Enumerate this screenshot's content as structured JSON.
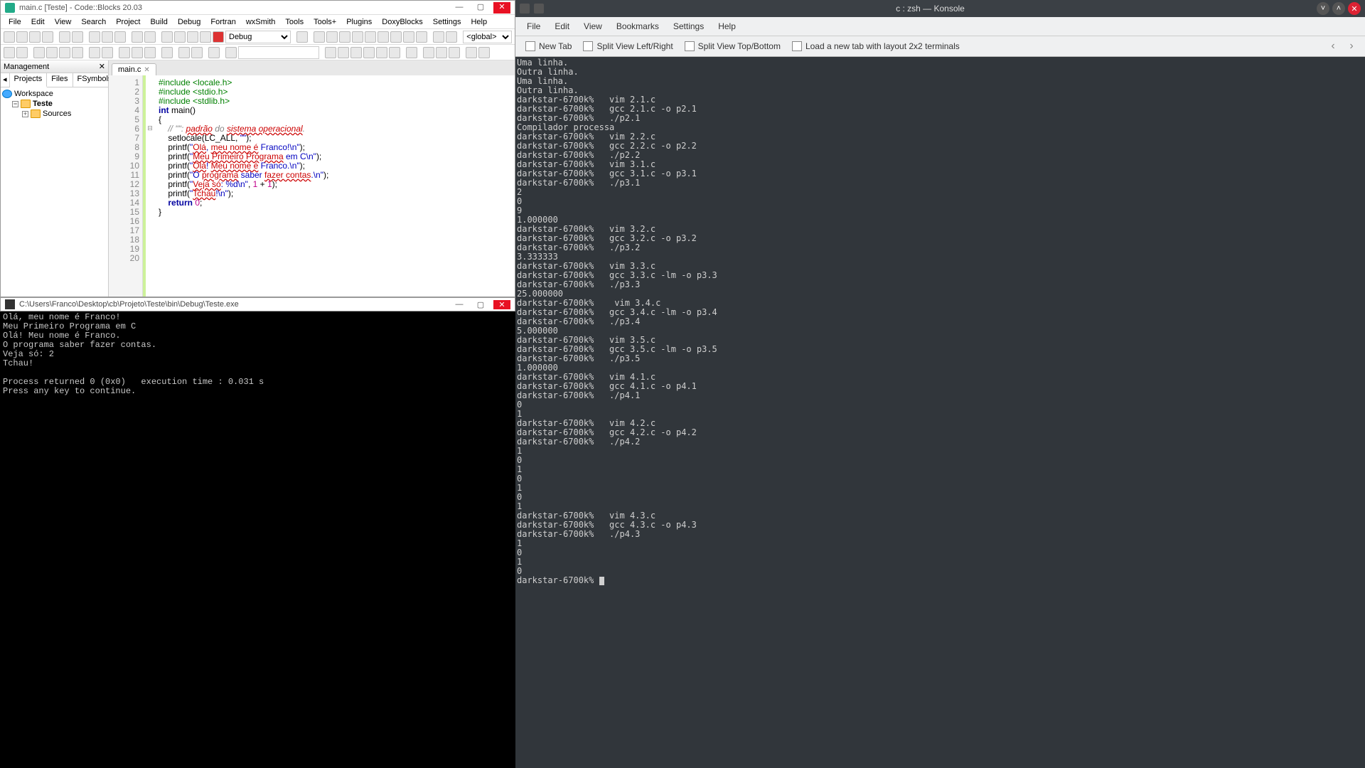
{
  "cb": {
    "title": "main.c [Teste] - Code::Blocks 20.03",
    "menu": [
      "File",
      "Edit",
      "View",
      "Search",
      "Project",
      "Build",
      "Debug",
      "Fortran",
      "wxSmith",
      "Tools",
      "Tools+",
      "Plugins",
      "DoxyBlocks",
      "Settings",
      "Help"
    ],
    "config": "Debug",
    "scope": "<global>",
    "management": {
      "title": "Management",
      "tabs": [
        "Projects",
        "Files",
        "FSymbols"
      ],
      "arrow": "▸",
      "tree": {
        "workspace": "Workspace",
        "project": "Teste",
        "sources": "Sources"
      }
    },
    "editor": {
      "tab": "main.c",
      "lines": 20,
      "code": [
        {
          "n": 1,
          "t": "pp",
          "text": "#include <locale.h>"
        },
        {
          "n": 2,
          "t": "pp",
          "text": "#include <stdio.h>"
        },
        {
          "n": 3,
          "t": "pp",
          "text": "#include <stdlib.h>"
        },
        {
          "n": 4,
          "t": "",
          "text": ""
        },
        {
          "n": 5,
          "t": "",
          "html": "<span class='kw'>int</span> main()"
        },
        {
          "n": 6,
          "t": "",
          "text": "{",
          "fold": "⊟"
        },
        {
          "n": 7,
          "t": "",
          "html": "    <span class='cm'>// \"\": <span class='uw'>padrão</span> do <span class='uw'>sistema operacional</span>.</span>"
        },
        {
          "n": 8,
          "t": "",
          "html": "    setlocale(LC_ALL, <span class='str'>\"\"</span>);"
        },
        {
          "n": 9,
          "t": "",
          "text": ""
        },
        {
          "n": 10,
          "t": "",
          "html": "    printf(<span class='str'>\"<span class='uw'>Olá</span>, <span class='uw'>meu nome é</span> Franco!\\n\"</span>);"
        },
        {
          "n": 11,
          "t": "",
          "text": ""
        },
        {
          "n": 12,
          "t": "",
          "html": "    printf(<span class='str'>\"<span class='uw'>Meu Primeiro Programa</span> em C\\n\"</span>);"
        },
        {
          "n": 13,
          "t": "",
          "html": "    printf(<span class='str'>\"<span class='uw'>Olá</span>! <span class='uw'>Meu nome é</span> Franco.\\n\"</span>);"
        },
        {
          "n": 14,
          "t": "",
          "html": "    printf(<span class='str'>\"O <span class='uw'>programa</span> saber <span class='uw'>fazer contas</span>.\\n\"</span>);"
        },
        {
          "n": 15,
          "t": "",
          "html": "    printf(<span class='str'>\"<span class='uw'>Veja só</span>: %d\\n\"</span>, <span class='num'>1</span> + <span class='num'>1</span>);"
        },
        {
          "n": 16,
          "t": "",
          "html": "    printf(<span class='str'>\"<span class='uw'>Tchau</span>!\\n\"</span>);"
        },
        {
          "n": 17,
          "t": "",
          "text": ""
        },
        {
          "n": 18,
          "t": "",
          "html": "    <span class='kw'>return</span> <span class='num'>0</span>;"
        },
        {
          "n": 19,
          "t": "",
          "text": "}"
        },
        {
          "n": 20,
          "t": "",
          "text": ""
        }
      ]
    }
  },
  "cmd": {
    "title": "C:\\Users\\Franco\\Desktop\\cb\\Projeto\\Teste\\bin\\Debug\\Teste.exe",
    "lines": [
      "Olá, meu nome é Franco!",
      "Meu Primeiro Programa em C",
      "Olá! Meu nome é Franco.",
      "O programa saber fazer contas.",
      "Veja só: 2",
      "Tchau!",
      "",
      "Process returned 0 (0x0)   execution time : 0.031 s",
      "Press any key to continue."
    ]
  },
  "kon": {
    "title": "c : zsh — Konsole",
    "menu": [
      "File",
      "Edit",
      "View",
      "Bookmarks",
      "Settings",
      "Help"
    ],
    "tool": {
      "newtab": "New Tab",
      "splitlr": "Split View Left/Right",
      "splittb": "Split View Top/Bottom",
      "layout": "Load a new tab with layout 2x2 terminals"
    },
    "prompt": "darkstar-6700k%",
    "lines": [
      "Uma linha.",
      "Outra linha.",
      "Uma linha.",
      "Outra linha.",
      "darkstar-6700k%   vim 2.1.c",
      "darkstar-6700k%   gcc 2.1.c -o p2.1",
      "darkstar-6700k%   ./p2.1",
      "Compilador processa",
      "darkstar-6700k%   vim 2.2.c",
      "darkstar-6700k%   gcc 2.2.c -o p2.2",
      "darkstar-6700k%   ./p2.2",
      "darkstar-6700k%   vim 3.1.c",
      "darkstar-6700k%   gcc 3.1.c -o p3.1",
      "darkstar-6700k%   ./p3.1",
      "2",
      "0",
      "9",
      "1.000000",
      "darkstar-6700k%   vim 3.2.c",
      "darkstar-6700k%   gcc 3.2.c -o p3.2",
      "darkstar-6700k%   ./p3.2",
      "3.333333",
      "darkstar-6700k%   vim 3.3.c",
      "darkstar-6700k%   gcc 3.3.c -lm -o p3.3",
      "darkstar-6700k%   ./p3.3",
      "25.000000",
      "darkstar-6700k%    vim 3.4.c",
      "darkstar-6700k%   gcc 3.4.c -lm -o p3.4",
      "darkstar-6700k%   ./p3.4",
      "5.000000",
      "darkstar-6700k%   vim 3.5.c",
      "darkstar-6700k%   gcc 3.5.c -lm -o p3.5",
      "darkstar-6700k%   ./p3.5",
      "1.000000",
      "darkstar-6700k%   vim 4.1.c",
      "darkstar-6700k%   gcc 4.1.c -o p4.1",
      "darkstar-6700k%   ./p4.1",
      "0",
      "1",
      "darkstar-6700k%   vim 4.2.c",
      "darkstar-6700k%   gcc 4.2.c -o p4.2",
      "darkstar-6700k%   ./p4.2",
      "1",
      "0",
      "1",
      "0",
      "1",
      "0",
      "1",
      "darkstar-6700k%   vim 4.3.c",
      "darkstar-6700k%   gcc 4.3.c -o p4.3",
      "darkstar-6700k%   ./p4.3",
      "1",
      "0",
      "1",
      "0"
    ]
  }
}
